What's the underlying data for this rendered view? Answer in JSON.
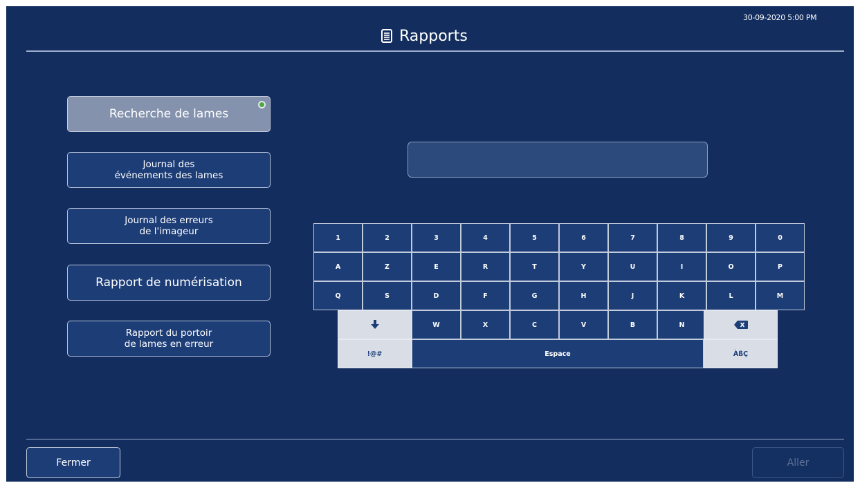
{
  "header": {
    "title": "Rapports",
    "title_icon": "document-list-icon",
    "timestamp": "30-09-2020 5:00 PM"
  },
  "menu": [
    {
      "label": "Recherche de lames",
      "selected": true
    },
    {
      "label": "Journal des\névénements des lames",
      "selected": false
    },
    {
      "label": "Journal des erreurs\nde l'imageur",
      "selected": false
    },
    {
      "label": "Rapport de numérisation",
      "selected": false
    },
    {
      "label": "Rapport du portoir\nde lames en erreur",
      "selected": false
    }
  ],
  "search": {
    "value": "",
    "placeholder": ""
  },
  "keyboard": {
    "row1": [
      "1",
      "2",
      "3",
      "4",
      "5",
      "6",
      "7",
      "8",
      "9",
      "0"
    ],
    "row2": [
      "A",
      "Z",
      "E",
      "R",
      "T",
      "Y",
      "U",
      "I",
      "O",
      "P"
    ],
    "row3": [
      "Q",
      "S",
      "D",
      "F",
      "G",
      "H",
      "J",
      "K",
      "L",
      "M"
    ],
    "row4": [
      "W",
      "X",
      "C",
      "V",
      "B",
      "N"
    ],
    "shift_icon": "arrow-down-icon",
    "backspace_icon": "backspace-icon",
    "symbols_label": "!@#",
    "space_label": "Espace",
    "accents_label": "ÀßÇ"
  },
  "footer": {
    "close_label": "Fermer",
    "go_label": "Aller",
    "go_enabled": false
  },
  "colors": {
    "background": "#122d5e",
    "button": "#1d3d77",
    "selected_button": "#8492ad",
    "active_indicator": "#4aa83f",
    "light_key": "#d8dde6"
  }
}
